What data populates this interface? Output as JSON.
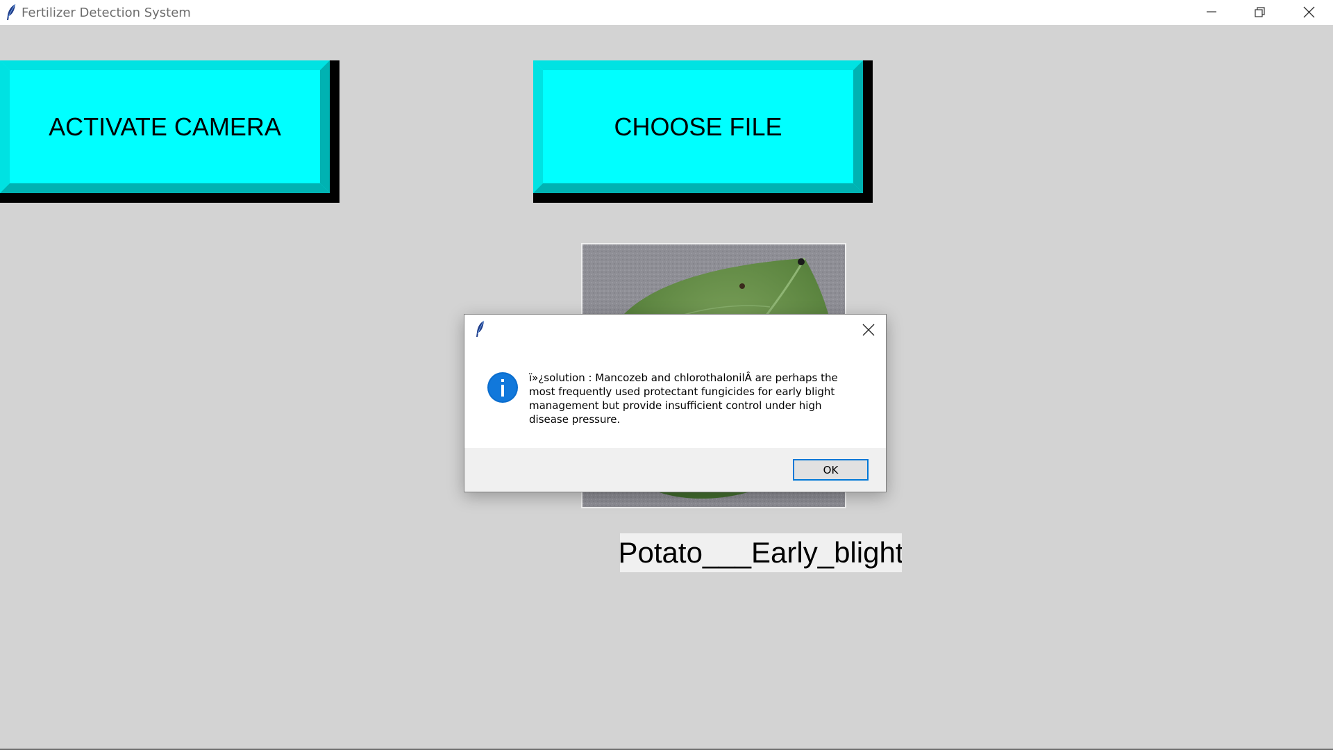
{
  "window": {
    "title": "Fertilizer Detection System",
    "icon": "feather-icon"
  },
  "title_bar": {
    "minimize_icon": "minimize-icon",
    "maximize_icon": "restore-icon",
    "close_icon": "close-icon"
  },
  "buttons": {
    "activate_camera": "ACTIVATE CAMERA",
    "choose_file": "CHOOSE FILE",
    "face_color": "#00ffff",
    "bevel_light": "#00e0e0",
    "shadow_color": "#000000"
  },
  "image": {
    "subject": "potato-leaf-photo"
  },
  "result": {
    "label": "Potato___Early_blight"
  },
  "dialog": {
    "icon": "feather-icon",
    "info_icon": "information-icon",
    "message": "ï»¿solution : Mancozeb and chlorothalonilÂ are perhaps the most frequently used protectant fungicides for early blight management but provide insufficient control under high disease pressure.",
    "ok_label": "OK",
    "accent_color": "#0078d7"
  },
  "colors": {
    "background": "#d3d3d3",
    "title_bar": "#ffffff"
  }
}
